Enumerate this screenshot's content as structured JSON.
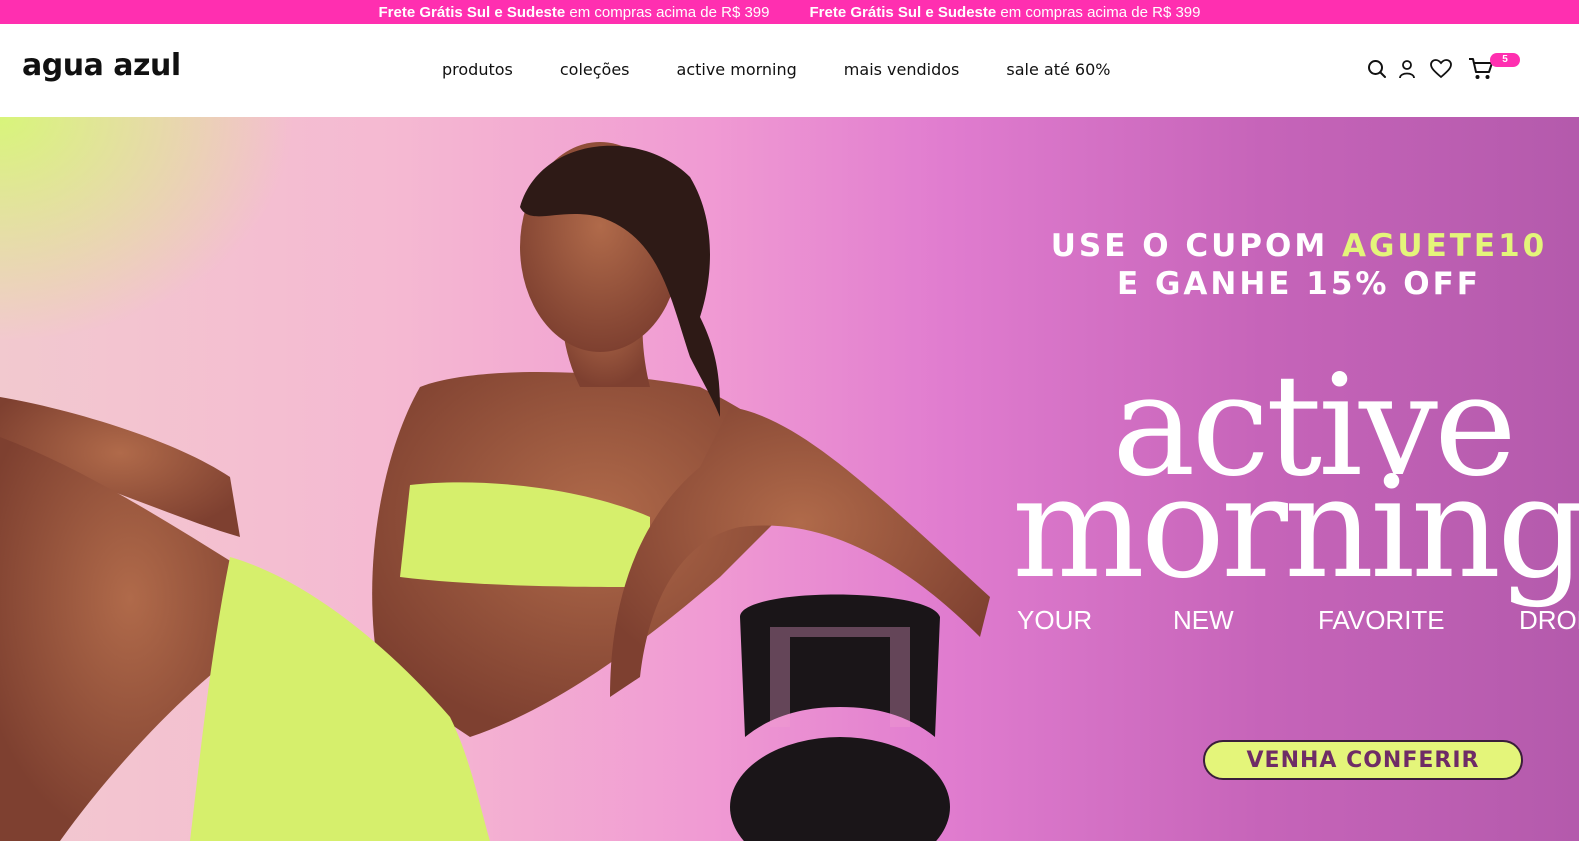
{
  "topbar": {
    "messages": [
      {
        "bold": "Frete Grátis Sul e Sudeste",
        "rest": " em compras acima de R$ 399"
      },
      {
        "bold": "Frete Grátis Sul e Sudeste",
        "rest": " em compras acima de R$ 399"
      }
    ]
  },
  "header": {
    "logo": "agua azul",
    "nav": [
      "produtos",
      "coleções",
      "active morning",
      "mais vendidos",
      "sale até 60%"
    ],
    "cart_count": "5"
  },
  "hero": {
    "coupon_line1_prefix": "USE O CUPOM ",
    "coupon_code": "AGUETE10",
    "coupon_line2": "E GANHE 15% OFF",
    "title_line1": "active",
    "title_line2": "morning",
    "tagline": [
      "YOUR",
      "NEW",
      "FAVORITE",
      "DROP"
    ],
    "cta_label": "VENHA CONFERIR"
  },
  "colors": {
    "accent_pink": "#ff2fb0",
    "lime": "#e4f57a",
    "cta_text": "#6e2c66"
  },
  "icons": [
    "search-icon",
    "user-icon",
    "heart-icon",
    "cart-icon"
  ]
}
